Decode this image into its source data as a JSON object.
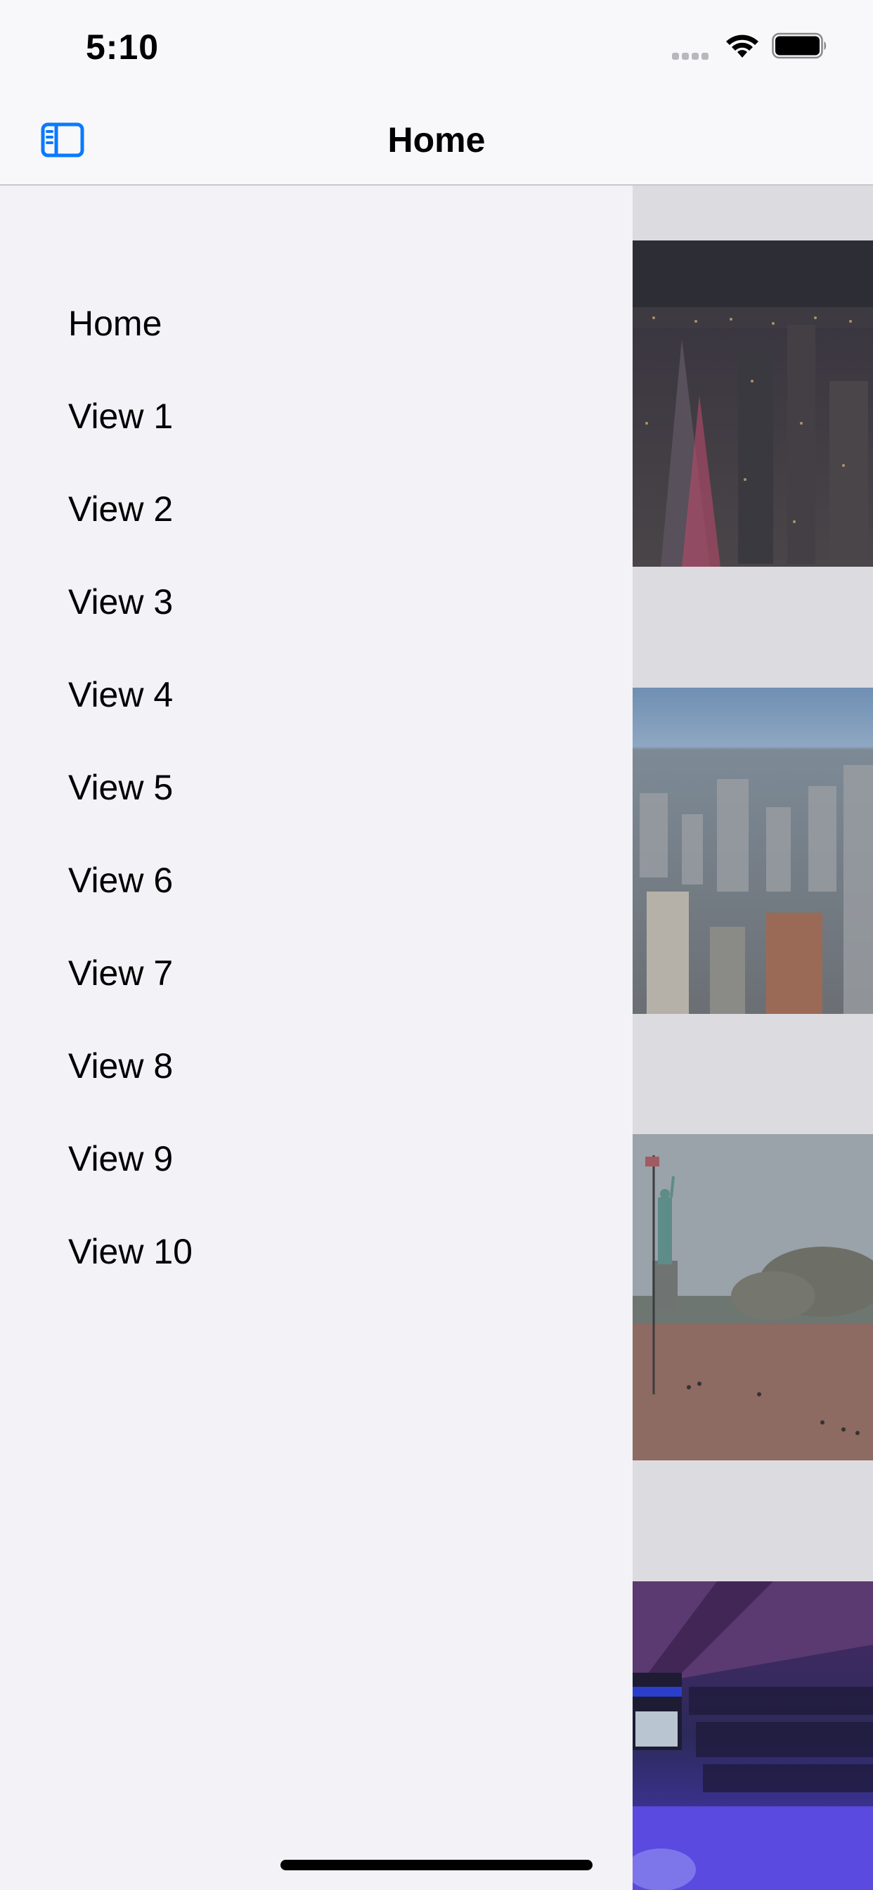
{
  "status_bar": {
    "time": "5:10",
    "icons": [
      "cellular-signal-icon",
      "wifi-icon",
      "battery-icon"
    ]
  },
  "nav_bar": {
    "title": "Home",
    "left_button_icon": "sidebar-toggle-icon",
    "accent_color": "#0a7aff"
  },
  "sidebar": {
    "items": [
      {
        "label": "Home"
      },
      {
        "label": "View 1"
      },
      {
        "label": "View 2"
      },
      {
        "label": "View 3"
      },
      {
        "label": "View 4"
      },
      {
        "label": "View 5"
      },
      {
        "label": "View 6"
      },
      {
        "label": "View 7"
      },
      {
        "label": "View 8"
      },
      {
        "label": "View 9"
      },
      {
        "label": "View 10"
      }
    ]
  },
  "content": {
    "photos": [
      "night-city-skyline",
      "day-city-skyline",
      "statue-of-liberty-plaza",
      "hockey-arena"
    ]
  }
}
